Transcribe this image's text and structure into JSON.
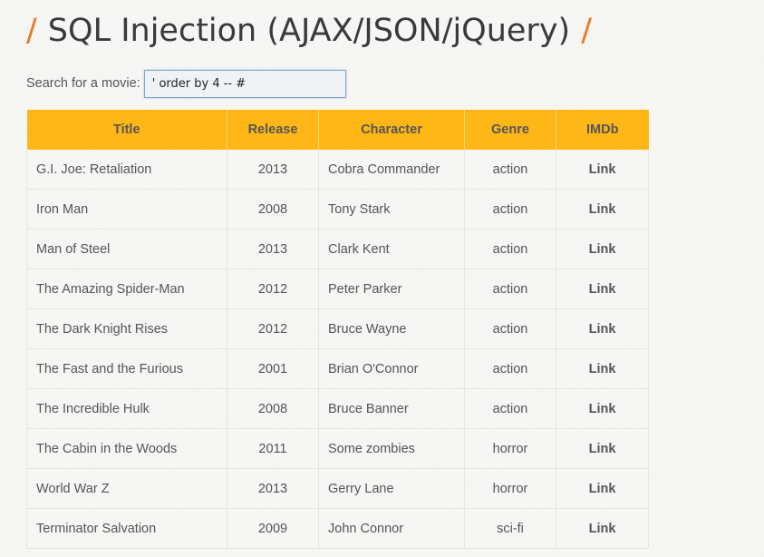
{
  "heading": {
    "slash": "/",
    "title": "SQL Injection (AJAX/JSON/jQuery)"
  },
  "search": {
    "label": "Search for a movie:",
    "value": "' order by 4 -- #"
  },
  "table": {
    "headers": [
      "Title",
      "Release",
      "Character",
      "Genre",
      "IMDb"
    ],
    "rows": [
      {
        "title": "G.I. Joe: Retaliation",
        "release": "2013",
        "character": "Cobra Commander",
        "genre": "action",
        "imdb": "Link"
      },
      {
        "title": "Iron Man",
        "release": "2008",
        "character": "Tony Stark",
        "genre": "action",
        "imdb": "Link"
      },
      {
        "title": "Man of Steel",
        "release": "2013",
        "character": "Clark Kent",
        "genre": "action",
        "imdb": "Link"
      },
      {
        "title": "The Amazing Spider-Man",
        "release": "2012",
        "character": "Peter Parker",
        "genre": "action",
        "imdb": "Link"
      },
      {
        "title": "The Dark Knight Rises",
        "release": "2012",
        "character": "Bruce Wayne",
        "genre": "action",
        "imdb": "Link"
      },
      {
        "title": "The Fast and the Furious",
        "release": "2001",
        "character": "Brian O'Connor",
        "genre": "action",
        "imdb": "Link"
      },
      {
        "title": "The Incredible Hulk",
        "release": "2008",
        "character": "Bruce Banner",
        "genre": "action",
        "imdb": "Link"
      },
      {
        "title": "The Cabin in the Woods",
        "release": "2011",
        "character": "Some zombies",
        "genre": "horror",
        "imdb": "Link"
      },
      {
        "title": "World War Z",
        "release": "2013",
        "character": "Gerry Lane",
        "genre": "horror",
        "imdb": "Link"
      },
      {
        "title": "Terminator Salvation",
        "release": "2009",
        "character": "John Connor",
        "genre": "sci-fi",
        "imdb": "Link"
      }
    ]
  },
  "colors": {
    "accent_orange": "#ee7622",
    "table_header": "#ffb717"
  }
}
